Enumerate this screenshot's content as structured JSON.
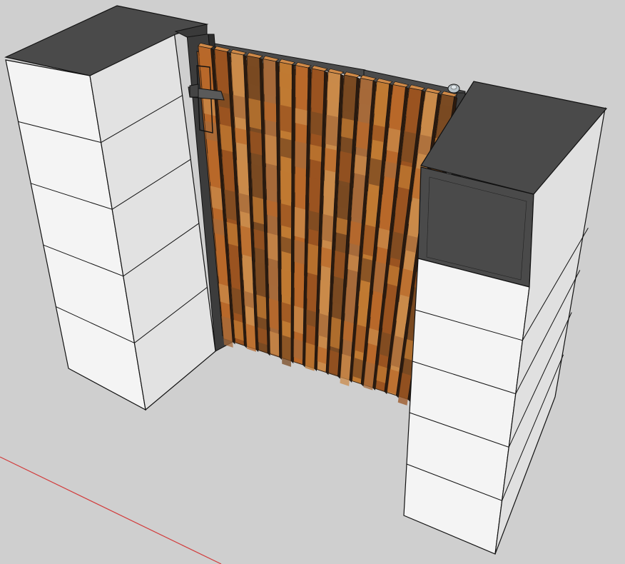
{
  "viewport": {
    "background_color": "#cfcfcf",
    "edge_color": "#111111"
  },
  "axes": {
    "red_axis_color": "#d23b3b"
  },
  "left_pillar": {
    "block_count": 5,
    "cap_color": "#4a4a4a",
    "face_light_color": "#f2f2f2",
    "face_shade_color": "#e0e0e0"
  },
  "right_pillar": {
    "block_count": 5,
    "cap_color": "#4a4a4a",
    "face_light_color": "#f2f2f2",
    "face_shade_color": "#dedede"
  },
  "gate": {
    "frame_color": "#3c3c3c",
    "slat_count": 16,
    "wood_colors": [
      "#b8682a",
      "#9a5320",
      "#c98a4a",
      "#7a4a22",
      "#a66a3a",
      "#c07a32"
    ],
    "slat_edge_color": "#3a2412"
  },
  "hardware": {
    "latch_color": "#555555",
    "hinge_color": "#b9c3c8"
  }
}
